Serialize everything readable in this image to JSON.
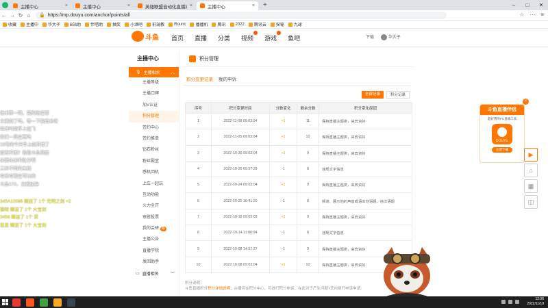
{
  "browser": {
    "tabs": [
      {
        "label": "主播中心",
        "active": false
      },
      {
        "label": "主播中心",
        "active": false
      },
      {
        "label": "英雄联盟自动化直播间",
        "active": false
      },
      {
        "label": "主播中心",
        "active": true
      }
    ],
    "new_tab": "+",
    "url": "https://mp.douyu.com/anchor/points/all",
    "bookmarks": [
      "收藏",
      "主播中",
      "华大子",
      "B站助",
      "伴唱助",
      "抽奖",
      "小酒吧",
      "前端教",
      "Rounc",
      "播播机",
      "腾讯",
      "2022",
      "腾讯云",
      "探秘",
      "九球"
    ]
  },
  "site": {
    "logo_text": "斗鱼",
    "nav": [
      {
        "label": "首页",
        "hot": false
      },
      {
        "label": "直播",
        "hot": false
      },
      {
        "label": "分类",
        "hot": false
      },
      {
        "label": "视频",
        "hot": true
      },
      {
        "label": "游戏",
        "hot": true
      },
      {
        "label": "鱼吧",
        "hot": false
      }
    ],
    "download": "下载",
    "username": "华大子"
  },
  "sidebar": {
    "title": "主播中心",
    "group_label": "主播相关",
    "items": [
      {
        "label": "主播等级",
        "active": false,
        "badge": ""
      },
      {
        "label": "主播口碑",
        "active": false,
        "badge": ""
      },
      {
        "label": "加V认证",
        "active": false,
        "badge": ""
      },
      {
        "label": "积分管理",
        "active": true,
        "badge": ""
      },
      {
        "label": "签约中心",
        "active": false,
        "badge": ""
      },
      {
        "label": "签约推单",
        "active": false,
        "badge": ""
      },
      {
        "label": "钻石粉丝",
        "active": false,
        "badge": ""
      },
      {
        "label": "粉丝殿堂",
        "active": false,
        "badge": ""
      },
      {
        "label": "感机回机",
        "active": false,
        "badge": ""
      },
      {
        "label": "上车一起玩",
        "active": false,
        "badge": ""
      },
      {
        "label": "互动功能",
        "active": false,
        "badge": ""
      },
      {
        "label": "火力全开",
        "active": false,
        "badge": ""
      },
      {
        "label": "审慰投票",
        "active": false,
        "badge": ""
      },
      {
        "label": "我的会研",
        "active": false,
        "badge": "新"
      },
      {
        "label": "主播公告",
        "active": false,
        "badge": ""
      },
      {
        "label": "直播学院",
        "active": false,
        "badge": ""
      },
      {
        "label": "发回助手",
        "active": false,
        "badge": ""
      }
    ],
    "group2_label": "直播相关"
  },
  "panel": {
    "title": "积分管理",
    "tabs": [
      {
        "label": "积分变更记录",
        "active": true
      },
      {
        "label": "我的申诉",
        "active": false
      }
    ],
    "btn_all": "全部记录",
    "btn_points": "积分记录",
    "columns": [
      "序号",
      "积分变更时间",
      "分数变化",
      "剩余分数",
      "积分变化原因"
    ],
    "rows": [
      {
        "no": "1",
        "time": "2022-11-08 09:03:04",
        "change": "+1",
        "remain": "11",
        "reason": "保持直播主题类，来宾资好"
      },
      {
        "no": "2",
        "time": "2022-11-05 09:03:04",
        "change": "+1",
        "remain": "10",
        "reason": "保持直播主题类，来宾资好"
      },
      {
        "no": "3",
        "time": "2022-10-30 09:03:04",
        "change": "+1",
        "remain": "9",
        "reason": "保持直播主题类，来宾资好"
      },
      {
        "no": "4",
        "time": "2022-10-26 09:57:29",
        "change": "-1",
        "remain": "8",
        "reason": "违规文字信息"
      },
      {
        "no": "5",
        "time": "2022-10-24 09:03:04",
        "change": "+1",
        "remain": "9",
        "reason": "保持直播主题类，来宾资好"
      },
      {
        "no": "6",
        "time": "2022-10-20 10:41:20",
        "change": "-1",
        "remain": "8",
        "reason": "频道、展示他的声音或语出他语题，违法语题"
      },
      {
        "no": "7",
        "time": "2022-10-18 09:03:03",
        "change": "+1",
        "remain": "9",
        "reason": "保持直播主题类，来宾资好"
      },
      {
        "no": "8",
        "time": "2022-10-14 11:06:04",
        "change": "-1",
        "remain": "8",
        "reason": "违规文字信息"
      },
      {
        "no": "9",
        "time": "2022-10-08 14:57:27",
        "change": "-1",
        "remain": "9",
        "reason": "保持直播主题类，来宾资好"
      },
      {
        "no": "10",
        "time": "2022-10-08 09:03:04",
        "change": "+1",
        "remain": "10",
        "reason": "保持直播主题类，来宾资好"
      }
    ],
    "note_title": "积分说明：",
    "note_pre": "斗鱼直播积分",
    "note_highlight": "积分详细说明",
    "note_post": "，主播可在积分中心，可进行积分申诉，在此对于产生问题7天内提行申诉申请。"
  },
  "overlay": {
    "white_lines": [
      "谁来第一啊，我的账在哪",
      "主播到了吗，等一下我再来呀",
      "每日时间早上起飞",
      "你们一直在玩吗",
      "13号的今天早上就开播了",
      "是否开播？看看斗鱼直播",
      "来猜未来的比分啊",
      "三种不同的主播",
      "有没有现在可以的",
      "斗鱼173，主播加油"
    ],
    "yellow_lines": [
      "345A10086 赠送了 1个 光明之剑 ×2",
      "猫咪 赠送了 1个 大宝剑",
      "3456 赠送了 1个 荧",
      "思思 赠送了 1个 大宝剑"
    ]
  },
  "promo": {
    "title": "斗鱼直播伴侣",
    "subtitle": "超好用的PC直播工具",
    "app_label": "DOUYU",
    "button": "立即下载",
    "close": "×"
  },
  "floatbar": [
    "▶",
    "⌂",
    "▦",
    "◫"
  ],
  "taskbar": {
    "time": "12:06",
    "date": "2022/11/10"
  },
  "colors": {
    "brand": "#ff7700",
    "positive": "#e2a000",
    "overlay_yellow": "#ffff33"
  }
}
